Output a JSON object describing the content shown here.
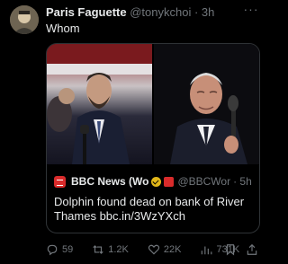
{
  "tweet": {
    "author_name": "Paris Faguette",
    "author_handle": "@tonykchoi",
    "time": "· 3h",
    "text": "Whom"
  },
  "quote": {
    "author_name": "BBC News (Wo",
    "author_handle": "@BBCWor",
    "time": "· 5h",
    "text": "Dolphin found dead on bank of River Thames bbc.in/3WzYXch"
  },
  "actions": {
    "replies": "59",
    "reposts": "1.2K",
    "likes": "22K",
    "views": "731K"
  },
  "colors": {
    "background": "#000000",
    "text": "#e7e9ea",
    "muted": "#71767b",
    "border": "#2f3336",
    "bbc_red": "#d92b2b",
    "verified_gold": "#e2b719"
  },
  "icons": [
    "more-icon",
    "bbc-logo-icon",
    "verified-badge-icon",
    "reply-icon",
    "repost-icon",
    "like-icon",
    "views-icon",
    "bookmark-icon",
    "share-icon"
  ]
}
